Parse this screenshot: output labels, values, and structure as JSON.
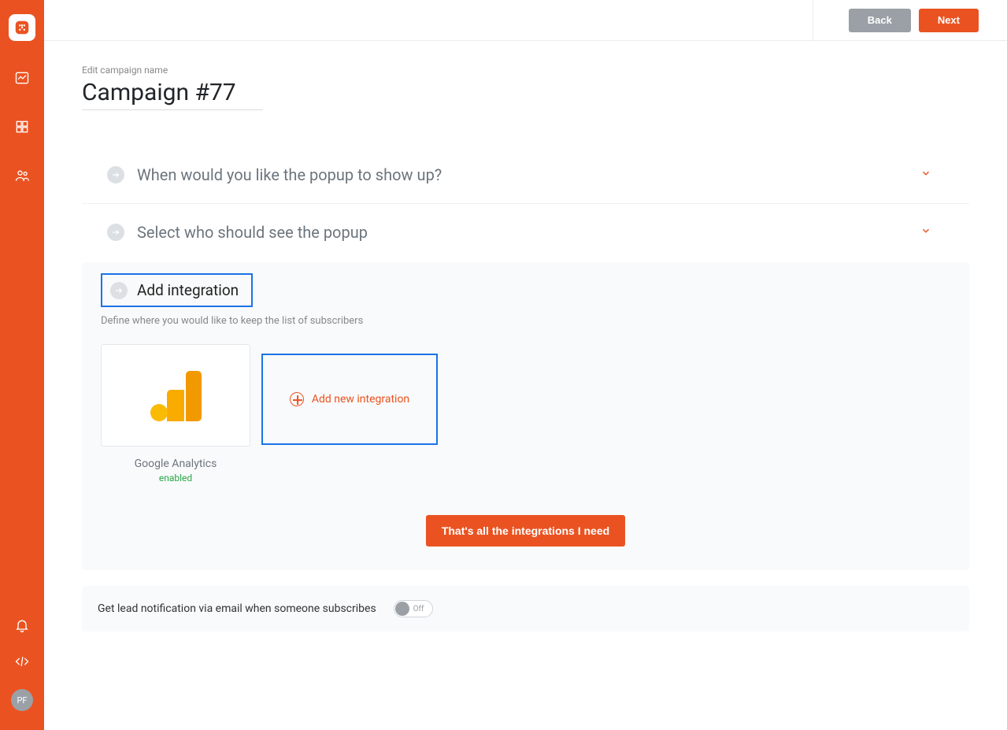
{
  "sidebar": {
    "avatar_initials": "PF"
  },
  "topbar": {
    "back_label": "Back",
    "next_label": "Next"
  },
  "campaign": {
    "edit_label": "Edit campaign name",
    "name": "Campaign #77"
  },
  "sections": [
    {
      "title": "When would you like the popup to show up?"
    },
    {
      "title": "Select who should see the popup"
    }
  ],
  "integration_panel": {
    "title": "Add integration",
    "subtitle": "Define where you would like to keep the list of subscribers",
    "items": [
      {
        "name": "Google Analytics",
        "status": "enabled"
      }
    ],
    "add_label": "Add new integration",
    "done_label": "That's all the integrations I need"
  },
  "notification": {
    "label": "Get lead notification via email when someone subscribes",
    "state": "Off"
  }
}
